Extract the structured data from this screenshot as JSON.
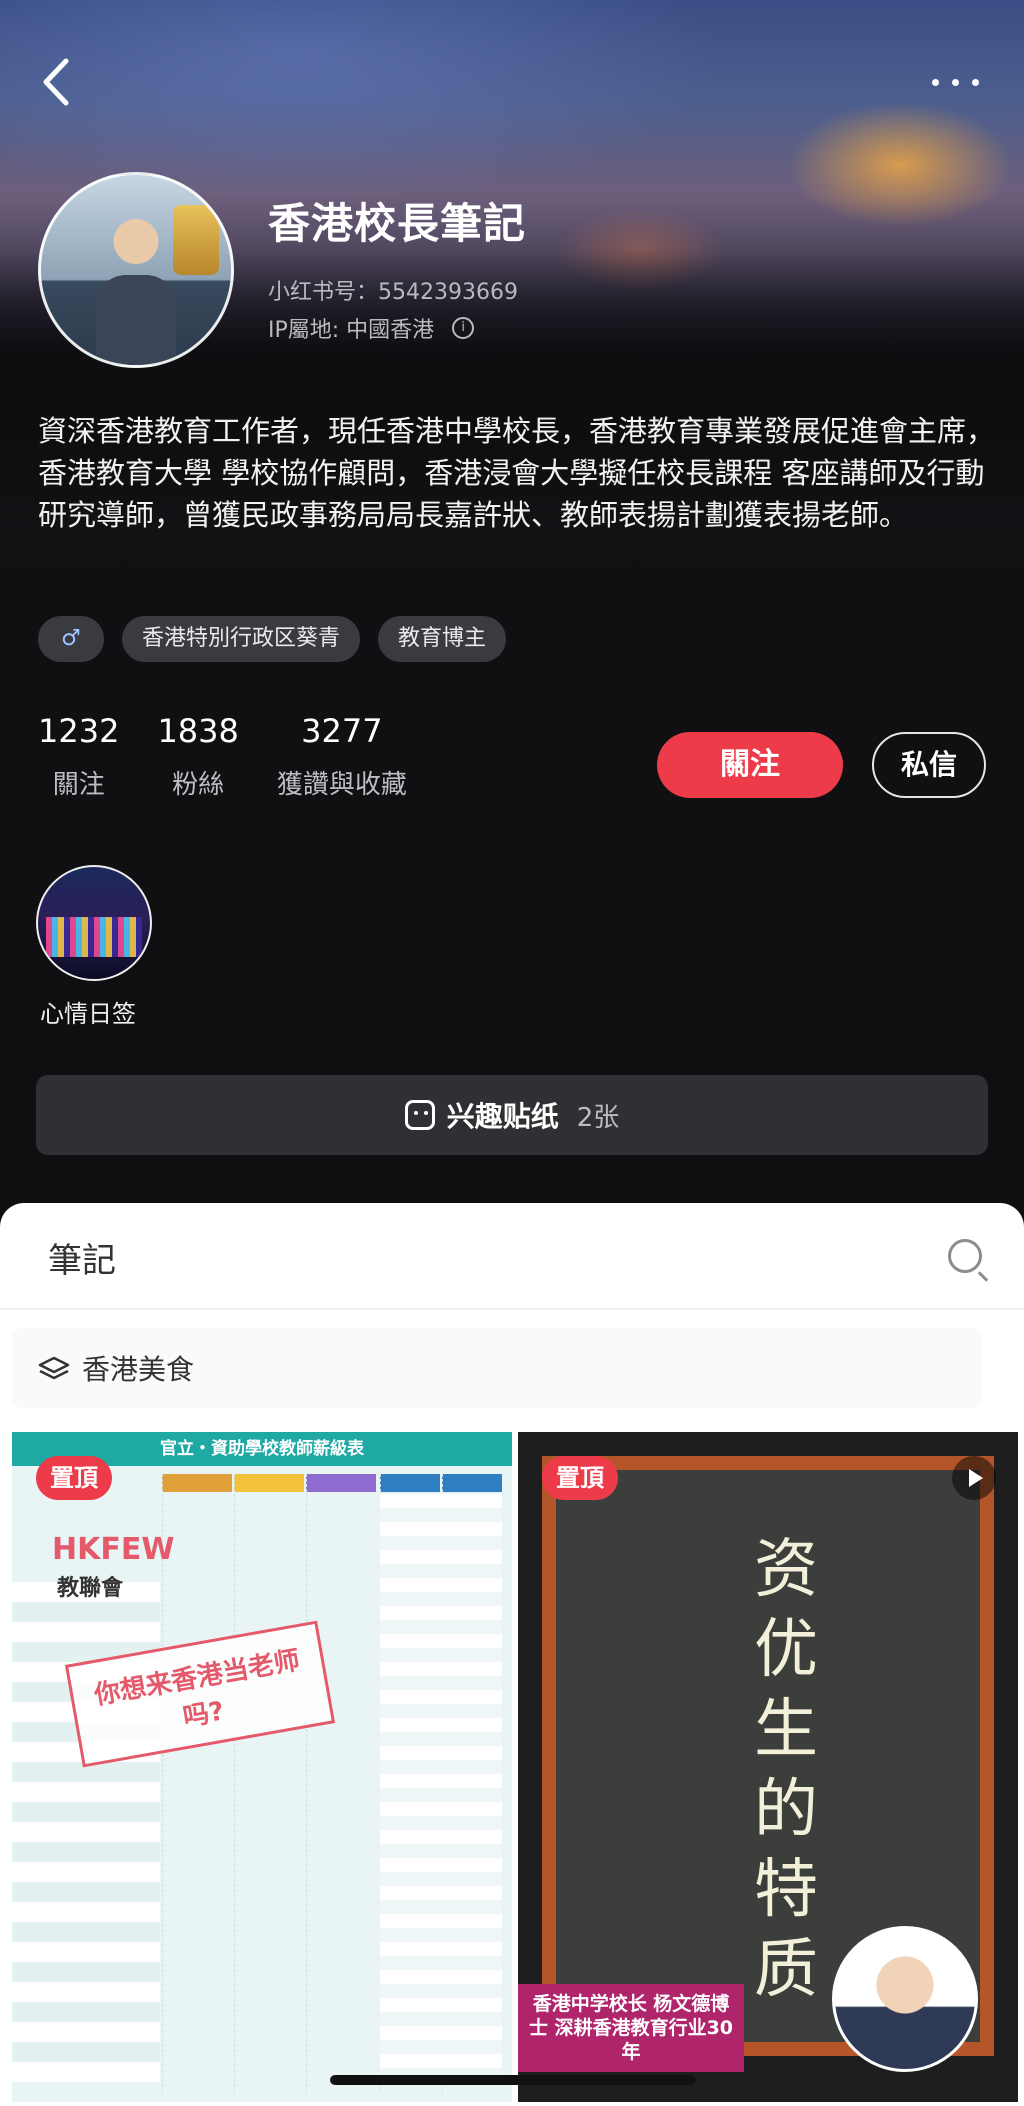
{
  "profile": {
    "name": "香港校長筆記",
    "red_id": "小红书号：5542393669",
    "ip_location": "IP屬地: 中國香港",
    "bio": "資深香港教育工作者，現任香港中學校長，香港教育專業發展促進會主席，香港教育大學 學校協作顧問，香港浸會大學擬任校長課程 客座講師及行動研究導師，曾獲民政事務局局長嘉許狀、教師表揚計劃獲表揚老師。",
    "tags": [
      {
        "label": "♂"
      },
      {
        "label": "香港特別行政区葵青"
      },
      {
        "label": "教育博主"
      }
    ],
    "stats": [
      {
        "value": "1232",
        "label": "關注"
      },
      {
        "value": "1838",
        "label": "粉絲"
      },
      {
        "value": "3277",
        "label": "獲讚與收藏"
      }
    ],
    "follow_label": "關注",
    "message_label": "私信"
  },
  "highlight": {
    "label": "心情日签"
  },
  "stickers": {
    "label": "兴趣贴纸",
    "count": "2张"
  },
  "notes": {
    "tab_label": "筆記",
    "collection_label": "香港美食",
    "cards": [
      {
        "pin_label": "置頂",
        "doc_title": "官立・資助學校教師薪級表",
        "logo": "HKFEW",
        "logo_sub": "教聯會",
        "overlay": "你想来香港当老师吗?"
      },
      {
        "pin_label": "置頂",
        "chalk_text": "资优生的特质",
        "caption": "香港中学校长 杨文德博士 深耕香港教育行业30年"
      }
    ]
  },
  "colors": {
    "accent": "#ee3b4a",
    "background": "#0e0e10",
    "panel": "#ffffff"
  }
}
